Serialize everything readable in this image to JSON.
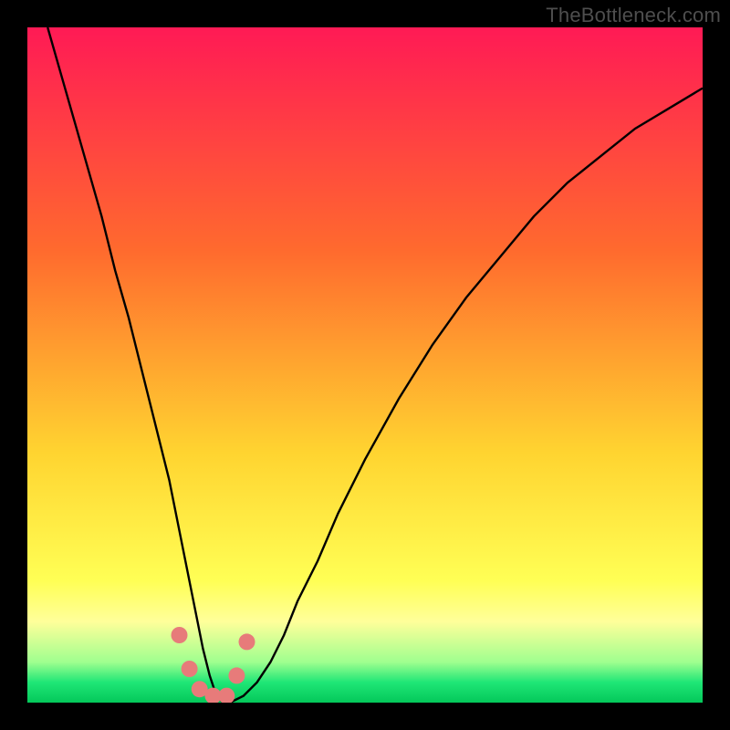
{
  "watermark": "TheBottleneck.com",
  "colors": {
    "bg": "#000000",
    "watermark": "#4e4e4e",
    "curve": "#000000",
    "marker": "#e77b7a",
    "grad_top": "#ff1a55",
    "grad_mid1": "#ff6a2e",
    "grad_mid2": "#ffd430",
    "grad_band": "#ffff9a",
    "grad_green": "#1fe676",
    "grad_bottom": "#04c85a"
  },
  "chart_data": {
    "type": "line",
    "title": "",
    "xlabel": "",
    "ylabel": "",
    "xlim": [
      0,
      100
    ],
    "ylim": [
      0,
      100
    ],
    "x": [
      3,
      5,
      7,
      9,
      11,
      13,
      15,
      17,
      19,
      21,
      22,
      23,
      24,
      25,
      26,
      27,
      28,
      29,
      30,
      32,
      34,
      36,
      38,
      40,
      43,
      46,
      50,
      55,
      60,
      65,
      70,
      75,
      80,
      85,
      90,
      95,
      100
    ],
    "y": [
      100,
      93,
      86,
      79,
      72,
      64,
      57,
      49,
      41,
      33,
      28,
      23,
      18,
      13,
      8,
      4,
      1,
      0,
      0,
      1,
      3,
      6,
      10,
      15,
      21,
      28,
      36,
      45,
      53,
      60,
      66,
      72,
      77,
      81,
      85,
      88,
      91
    ],
    "markers": {
      "x": [
        22.5,
        24.0,
        25.5,
        27.5,
        29.5,
        31.0,
        32.5
      ],
      "y": [
        10,
        5,
        2,
        1,
        1,
        4,
        9
      ]
    }
  }
}
